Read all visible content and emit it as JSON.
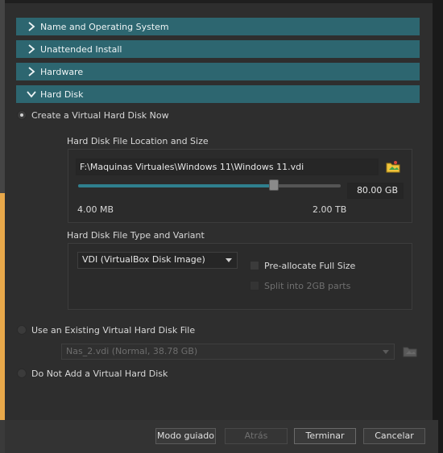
{
  "sections": [
    {
      "label": "Name and Operating System",
      "expanded": false
    },
    {
      "label": "Unattended Install",
      "expanded": false
    },
    {
      "label": "Hardware",
      "expanded": false
    },
    {
      "label": "Hard Disk",
      "expanded": true
    }
  ],
  "hard_disk": {
    "option_create": "Create a Virtual Hard Disk Now",
    "location_group_label": "Hard Disk File Location and Size",
    "file_path": "F:\\Maquinas Virtuales\\Windows 11\\Windows 11.vdi",
    "size_value": "80.00 GB",
    "size_fraction": 0.745,
    "size_min_label": "4.00 MB",
    "size_max_label": "2.00 TB",
    "type_group_label": "Hard Disk File Type and Variant",
    "type_selected": "VDI (VirtualBox Disk Image)",
    "preallocate_label": "Pre-allocate Full Size",
    "preallocate_checked": false,
    "split_label": "Split into 2GB parts",
    "split_enabled": false,
    "option_existing": "Use an Existing Virtual Hard Disk File",
    "existing_selected": "Nas_2.vdi (Normal, 38.78 GB)",
    "option_none": "Do Not Add a Virtual Hard Disk",
    "selected_option": "create"
  },
  "buttons": {
    "guided": "Modo guiado",
    "back": "Atrás",
    "finish": "Terminar",
    "cancel": "Cancelar"
  },
  "colors": {
    "section_header": "#2d6670",
    "slider_fill": "#2f7f8e",
    "left_accent": "#e8a84a"
  }
}
